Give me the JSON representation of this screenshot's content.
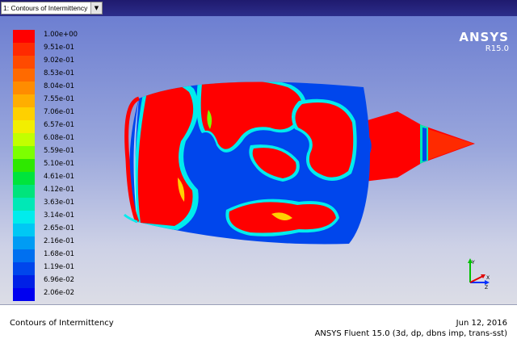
{
  "window": {
    "display_selector": "1: Contours of Intermittency"
  },
  "legend": {
    "items": [
      {
        "label": "1.00e+00",
        "color": "#ff0000"
      },
      {
        "label": "9.51e-01",
        "color": "#ff2a00"
      },
      {
        "label": "9.02e-01",
        "color": "#ff4a00"
      },
      {
        "label": "8.53e-01",
        "color": "#ff6a00"
      },
      {
        "label": "8.04e-01",
        "color": "#ff8c00"
      },
      {
        "label": "7.55e-01",
        "color": "#ffae00"
      },
      {
        "label": "7.06e-01",
        "color": "#ffd000"
      },
      {
        "label": "6.57e-01",
        "color": "#f2ee00"
      },
      {
        "label": "6.08e-01",
        "color": "#c2ff00"
      },
      {
        "label": "5.59e-01",
        "color": "#7cff00"
      },
      {
        "label": "5.10e-01",
        "color": "#2ee800"
      },
      {
        "label": "4.61e-01",
        "color": "#00e43c"
      },
      {
        "label": "4.12e-01",
        "color": "#00e47c"
      },
      {
        "label": "3.63e-01",
        "color": "#00e8b6"
      },
      {
        "label": "3.14e-01",
        "color": "#00ecec"
      },
      {
        "label": "2.65e-01",
        "color": "#00c8f4"
      },
      {
        "label": "2.16e-01",
        "color": "#009cf4"
      },
      {
        "label": "1.68e-01",
        "color": "#0070f0"
      },
      {
        "label": "1.19e-01",
        "color": "#0046ec"
      },
      {
        "label": "6.96e-02",
        "color": "#0020e6"
      },
      {
        "label": "2.06e-02",
        "color": "#0000f0"
      }
    ]
  },
  "logo": {
    "name": "ANSYS",
    "version": "R15.0"
  },
  "footer": {
    "title": "Contours of Intermittency",
    "date": "Jun 12, 2016",
    "solver": "ANSYS Fluent 15.0 (3d, dp, dbns imp, trans-sst)"
  },
  "icons": {
    "dropdown": "chevron-down-icon",
    "axes": "xyz-axes-triad-icon"
  }
}
